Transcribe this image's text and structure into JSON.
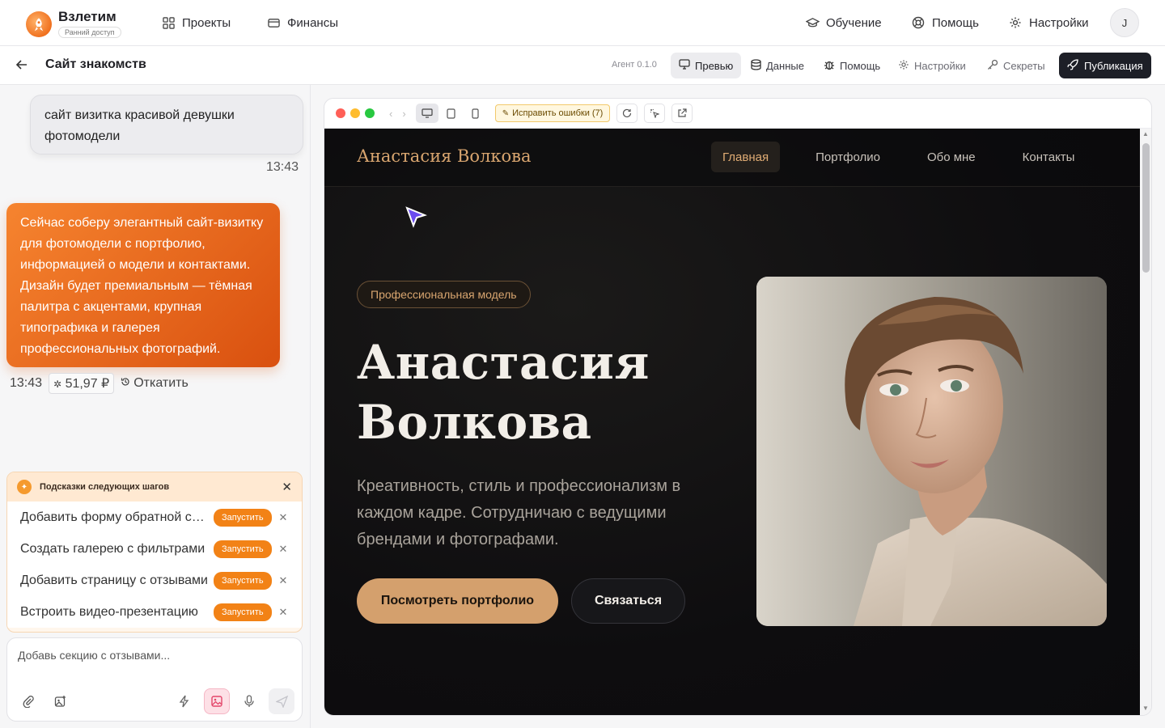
{
  "app": {
    "brand_name": "Взлетим",
    "brand_badge": "Ранний доступ",
    "nav_left": [
      {
        "label": "Проекты",
        "icon": "grid-icon"
      },
      {
        "label": "Финансы",
        "icon": "wallet-icon"
      }
    ],
    "nav_right": [
      {
        "label": "Обучение",
        "icon": "graduation-cap-icon"
      },
      {
        "label": "Помощь",
        "icon": "lifebuoy-icon"
      },
      {
        "label": "Настройки",
        "icon": "gear-icon"
      }
    ],
    "avatar_initial": "J"
  },
  "project": {
    "title": "Сайт знакомств",
    "agent_version": "Агент 0.1.0",
    "tabs": [
      {
        "label": "Превью",
        "icon": "monitor-icon",
        "active": true
      },
      {
        "label": "Данные",
        "icon": "database-icon"
      },
      {
        "label": "Помощь",
        "icon": "bug-icon"
      },
      {
        "label": "Настройки",
        "icon": "gear-icon"
      },
      {
        "label": "Секреты",
        "icon": "key-icon"
      }
    ],
    "publish_label": "Публикация"
  },
  "chat": {
    "user_message": "сайт визитка красивой девушки фотомодели",
    "user_time": "13:43",
    "bot_message": "Сейчас соберу элегантный сайт-визитку для фотомодели с портфолио, информацией о модели и контактами. Дизайн будет премиальным — тёмная палитра с акцентами, крупная типографика и галерея профессиональных фотографий.",
    "bot_time": "13:43",
    "cost": "51,97 ₽",
    "rollback_label": "Откатить"
  },
  "hints": {
    "title": "Подсказки следующих шагов",
    "run_label": "Запустить",
    "items": [
      "Добавить форму обратной связи",
      "Создать галерею с фильтрами",
      "Добавить страницу с отзывами",
      "Встроить видео-презентацию"
    ]
  },
  "composer": {
    "placeholder": "Добавь секцию с отзывами..."
  },
  "preview_bar": {
    "fix_errors_label": "Исправить ошибки (7)"
  },
  "site": {
    "logo": "Анастасия Волкова",
    "nav": [
      "Главная",
      "Портфолио",
      "Обо мне",
      "Контакты"
    ],
    "badge": "Профессиональная модель",
    "title_line1": "Анастасия",
    "title_line2": "Волкова",
    "subtitle": "Креативность, стиль и профессионализм в каждом кадре. Сотрудничаю с ведущими брендами и фотографами.",
    "btn_primary": "Посмотреть портфолио",
    "btn_secondary": "Связаться",
    "accent_color": "#d4a06d"
  }
}
